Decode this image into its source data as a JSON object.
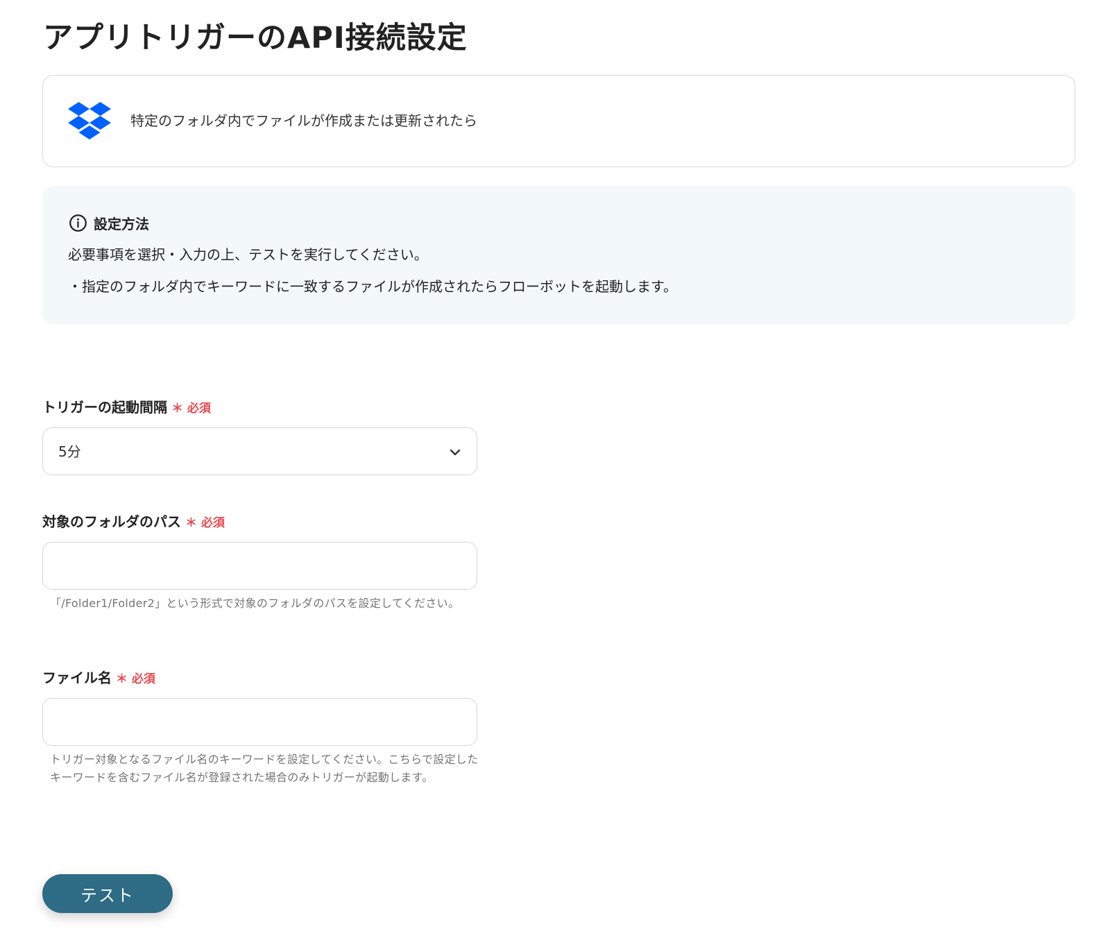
{
  "page": {
    "title": "アプリトリガーのAPI接続設定"
  },
  "trigger_card": {
    "app_icon": "dropbox-icon",
    "brand_color": "#0061fe",
    "description": "特定のフォルダ内でファイルが作成または更新されたら"
  },
  "info": {
    "icon": "info-circle-icon",
    "title": "設定方法",
    "lines": [
      "必要事項を選択・入力の上、テストを実行してください。",
      "・指定のフォルダ内でキーワードに一致するファイルが作成されたらフローボットを起動します。"
    ]
  },
  "form": {
    "required_mark": "＊ 必須",
    "required_color": "#e8494f",
    "interval": {
      "label": "トリガーの起動間隔",
      "value": "5分"
    },
    "folder_path": {
      "label": "対象のフォルダのパス",
      "value": "",
      "placeholder": "",
      "help": "「/Folder1/Folder2」という形式で対象のフォルダのパスを設定してください。"
    },
    "file_name": {
      "label": "ファイル名",
      "value": "",
      "placeholder": "",
      "help": "トリガー対象となるファイル名のキーワードを設定してください。こちらで設定したキーワードを含むファイル名が登録された場合のみトリガーが起動します。"
    }
  },
  "actions": {
    "test_label": "テスト",
    "button_color": "#2e6b85"
  }
}
